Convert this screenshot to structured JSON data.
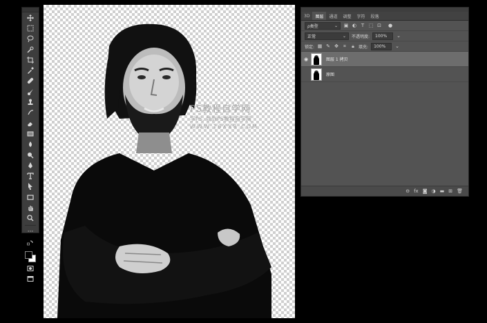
{
  "panel": {
    "tabs": [
      "3D",
      "图层",
      "通道",
      "调整",
      "字符",
      "段落"
    ],
    "filter_label": "ρ类型",
    "blend_mode": "正常",
    "opacity_label": "不透明度:",
    "opacity_value": "100%",
    "lock_label": "锁定:",
    "fill_label": "填充:",
    "fill_value": "100%",
    "layers": [
      {
        "name": "图层 1 拷贝",
        "visible": true,
        "selected": true
      },
      {
        "name": "原图",
        "visible": false,
        "selected": false
      }
    ],
    "footer_icons": [
      "link-icon",
      "fx-icon",
      "mask-icon",
      "adjustment-icon",
      "folder-icon",
      "new-layer-icon",
      "trash-icon"
    ],
    "fx_label": "fx"
  },
  "watermark": {
    "line1": "PS教程自学网",
    "line2": "学PS, 就到PS教程自学网",
    "line3": "WWW.16XX8.COM"
  },
  "colors": {
    "foreground": "#000000",
    "background": "#ffffff"
  }
}
